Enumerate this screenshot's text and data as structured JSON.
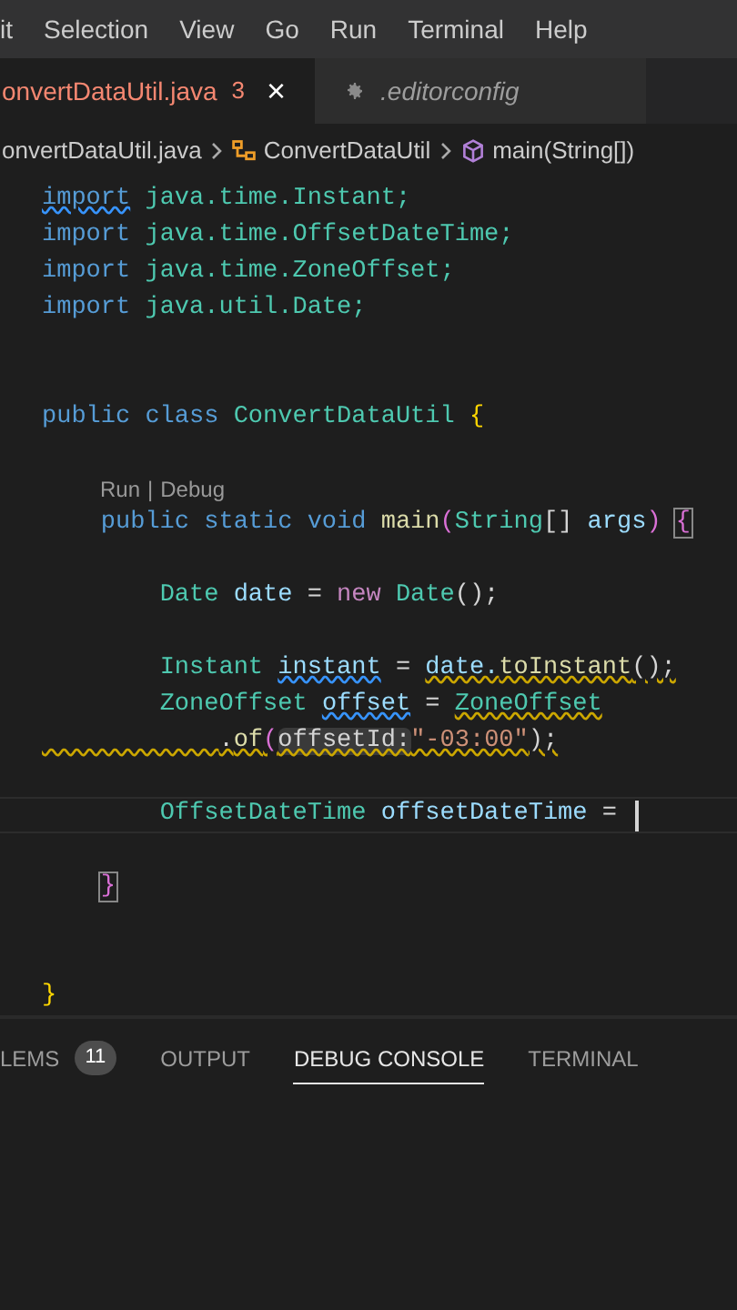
{
  "menu_bar": [
    "it",
    "Selection",
    "View",
    "Go",
    "Run",
    "Terminal",
    "Help"
  ],
  "tabs": [
    {
      "label": "onvertDataUtil.java",
      "selected": true,
      "has_errors": true,
      "badge": "3",
      "close": "×",
      "kind": "file"
    },
    {
      "label": ".editorconfig",
      "selected": false,
      "has_errors": false,
      "kind": "config"
    }
  ],
  "breadcrumb": [
    {
      "label": "onvertDataUtil.java",
      "kind": "file"
    },
    {
      "label": "ConvertDataUtil",
      "kind": "class"
    },
    {
      "label": "main(String[])",
      "kind": "method"
    }
  ],
  "code": [
    {
      "kind": "code",
      "tokens": [
        {
          "text": "import",
          "kind": "keyword",
          "info": true
        },
        {
          "text": " java.time.Instant;",
          "kind": "type"
        }
      ]
    },
    {
      "kind": "code",
      "tokens": [
        {
          "text": "import",
          "kind": "keyword"
        },
        {
          "text": " java.time.OffsetDateTime;",
          "kind": "type"
        }
      ]
    },
    {
      "kind": "code",
      "tokens": [
        {
          "text": "import",
          "kind": "keyword"
        },
        {
          "text": " java.time.ZoneOffset;",
          "kind": "type"
        }
      ]
    },
    {
      "kind": "code",
      "tokens": [
        {
          "text": "import",
          "kind": "keyword"
        },
        {
          "text": " java.util.Date;",
          "kind": "type"
        }
      ]
    },
    {
      "kind": "blank"
    },
    {
      "kind": "blank"
    },
    {
      "kind": "code",
      "tokens": [
        {
          "text": "public class ",
          "kind": "keyword"
        },
        {
          "text": "ConvertDataUtil ",
          "kind": "type"
        },
        {
          "text": "{",
          "kind": "bracket"
        }
      ]
    },
    {
      "kind": "blank"
    },
    {
      "kind": "codelens",
      "items": [
        "Run",
        "Debug"
      ],
      "separator": "|"
    },
    {
      "kind": "code",
      "tokens": [
        {
          "text": "    public static void ",
          "kind": "keyword"
        },
        {
          "text": "main",
          "kind": "function"
        },
        {
          "text": "(",
          "kind": "bracket2"
        },
        {
          "text": "String",
          "kind": "type"
        },
        {
          "text": "[] ",
          "kind": "punct"
        },
        {
          "text": "args",
          "kind": "variable"
        },
        {
          "text": ") ",
          "kind": "bracket2"
        },
        {
          "text": "{",
          "kind": "bracket2",
          "matched": true
        }
      ]
    },
    {
      "kind": "blank"
    },
    {
      "kind": "code",
      "tokens": [
        {
          "text": "        Date ",
          "kind": "type"
        },
        {
          "text": "date",
          "kind": "variable"
        },
        {
          "text": " = ",
          "kind": "punct"
        },
        {
          "text": "new ",
          "kind": "control"
        },
        {
          "text": "Date",
          "kind": "type"
        },
        {
          "text": "();",
          "kind": "punct"
        }
      ]
    },
    {
      "kind": "blank"
    },
    {
      "kind": "code",
      "tokens": [
        {
          "text": "        Instant ",
          "kind": "type"
        },
        {
          "text": "instant",
          "kind": "variable",
          "info": true
        },
        {
          "text": " = ",
          "kind": "punct"
        },
        {
          "text": "date.",
          "kind": "variable",
          "warning": true
        },
        {
          "text": "toInstant",
          "kind": "function",
          "warning": true
        },
        {
          "text": "();",
          "kind": "punct",
          "warning": true
        }
      ]
    },
    {
      "kind": "code",
      "tokens": [
        {
          "text": "        ZoneOffset ",
          "kind": "type"
        },
        {
          "text": "offset",
          "kind": "variable",
          "info": true
        },
        {
          "text": " = ",
          "kind": "punct"
        },
        {
          "text": "ZoneOffset",
          "kind": "type",
          "warning": true
        }
      ]
    },
    {
      "kind": "code",
      "warning": true,
      "tokens": [
        {
          "text": "            .",
          "kind": "punct"
        },
        {
          "text": "of",
          "kind": "function"
        },
        {
          "text": "(",
          "kind": "bracket2"
        },
        {
          "text": "offsetId:",
          "kind": "hint"
        },
        {
          "text": "\"-03:00\"",
          "kind": "string"
        },
        {
          "text": ");",
          "kind": "punct"
        }
      ]
    },
    {
      "kind": "blank"
    },
    {
      "kind": "code",
      "current": true,
      "cursor": true,
      "tokens": [
        {
          "text": "        OffsetDateTime ",
          "kind": "type"
        },
        {
          "text": "offsetDateTime",
          "kind": "variable"
        },
        {
          "text": " = ",
          "kind": "punct"
        }
      ]
    },
    {
      "kind": "blank"
    },
    {
      "kind": "code",
      "tokens": [
        {
          "text": "    }",
          "kind": "bracket2",
          "matched": true
        }
      ]
    },
    {
      "kind": "blank"
    },
    {
      "kind": "blank"
    },
    {
      "kind": "code",
      "tokens": [
        {
          "text": "}",
          "kind": "bracket"
        }
      ]
    }
  ],
  "panel_tabs": [
    {
      "label": "LEMS",
      "selected": false,
      "badge": "11"
    },
    {
      "label": "OUTPUT",
      "selected": false
    },
    {
      "label": "DEBUG CONSOLE",
      "selected": true
    },
    {
      "label": "TERMINAL",
      "selected": false
    }
  ]
}
